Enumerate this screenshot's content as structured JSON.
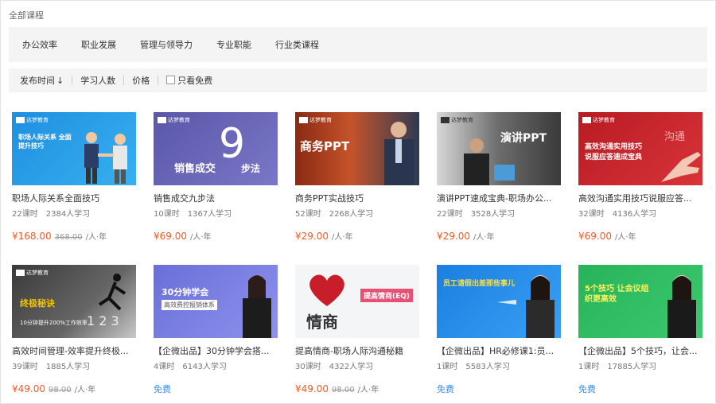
{
  "breadcrumb": "全部课程",
  "categories": [
    "办公效率",
    "职业发展",
    "管理与领导力",
    "专业职能",
    "行业类课程"
  ],
  "sort": {
    "publish_time": "发布时间",
    "learners": "学习人数",
    "price": "价格",
    "free_only": "只看免费"
  },
  "courses": [
    {
      "title": "职场人际关系全面技巧",
      "lessons": "22课时",
      "learners": "2384人学习",
      "price": "¥168.00",
      "orig": "368.00",
      "unit": "/人·年",
      "free": "",
      "thumb_text": "职场人际关系 全面提升技巧",
      "logo": "达梦教育"
    },
    {
      "title": "销售成交九步法",
      "lessons": "10课时",
      "learners": "1367人学习",
      "price": "¥69.00",
      "orig": "",
      "unit": "/人·年",
      "free": "",
      "thumb_text": "销售成交",
      "thumb_num": "9",
      "thumb_sub": "步法",
      "logo": "达梦教育"
    },
    {
      "title": "商务PPT实战技巧",
      "lessons": "52课时",
      "learners": "2268人学习",
      "price": "¥29.00",
      "orig": "",
      "unit": "/人·年",
      "free": "",
      "thumb_text": "商务PPT",
      "logo": "达梦教育"
    },
    {
      "title": "演讲PPT速成宝典-职场办公...",
      "lessons": "22课时",
      "learners": "3528人学习",
      "price": "¥29.00",
      "orig": "",
      "unit": "/人·年",
      "free": "",
      "thumb_text": "演讲PPT",
      "logo": "达梦教育"
    },
    {
      "title": "高效沟通实用技巧说服应答...",
      "lessons": "32课时",
      "learners": "4136人学习",
      "price": "¥69.00",
      "orig": "",
      "unit": "/人·年",
      "free": "",
      "thumb_text": "高效沟通实用技巧 说服应答速成宝典",
      "thumb_sub": "沟通",
      "logo": "达梦教育"
    },
    {
      "title": "高效时间管理-效率提升终极...",
      "lessons": "39课时",
      "learners": "1885人学习",
      "price": "¥49.00",
      "orig": "98.00",
      "unit": "/人·年",
      "free": "",
      "thumb_text": "终极秘诀",
      "thumb_sub": "10分钟提升200%工作效率",
      "logo": "达梦教育"
    },
    {
      "title": "【企微出品】30分钟学会搭...",
      "lessons": "4课时",
      "learners": "6143人学习",
      "price": "",
      "orig": "",
      "unit": "",
      "free": "免费",
      "thumb_text": "30分钟学会",
      "thumb_sub": "高效费控报销体系",
      "logo": ""
    },
    {
      "title": "提高情商-职场人际沟通秘籍",
      "lessons": "30课时",
      "learners": "4322人学习",
      "price": "¥49.00",
      "orig": "98.00",
      "unit": "/人·年",
      "free": "",
      "thumb_text": "情商",
      "thumb_sub": "提高情商(EQ)",
      "logo": ""
    },
    {
      "title": "【企微出品】HR必修课1:员...",
      "lessons": "1课时",
      "learners": "5583人学习",
      "price": "",
      "orig": "",
      "unit": "",
      "free": "免费",
      "thumb_text": "员工请假出差那些事儿",
      "logo": ""
    },
    {
      "title": "【企微出品】5个技巧，让会...",
      "lessons": "1课时",
      "learners": "17885人学习",
      "price": "",
      "orig": "",
      "unit": "",
      "free": "免费",
      "thumb_text": "5个技巧 让会议组织更高效",
      "logo": ""
    }
  ],
  "colors": {
    "price": "#f05a24",
    "free": "#3a8ee6"
  }
}
